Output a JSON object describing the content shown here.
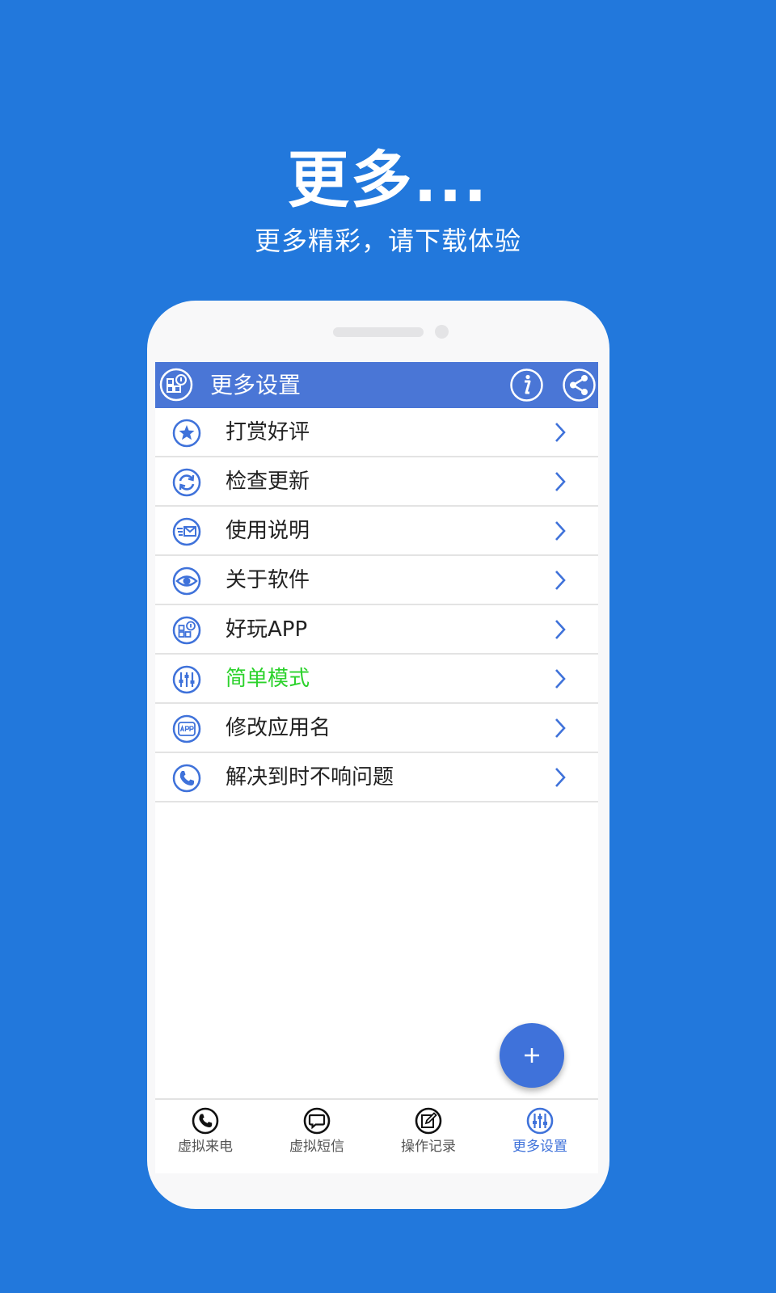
{
  "promo": {
    "title": "更多...",
    "subtitle": "更多精彩，请下载体验"
  },
  "appbar": {
    "title": "更多设置",
    "left_icon": "app-grid-icon",
    "right_icons": [
      "info-icon",
      "share-icon"
    ]
  },
  "menu": {
    "items": [
      {
        "label": "打赏好评",
        "icon": "star-icon"
      },
      {
        "label": "检查更新",
        "icon": "refresh-icon"
      },
      {
        "label": "使用说明",
        "icon": "mail-icon"
      },
      {
        "label": "关于软件",
        "icon": "eye-icon"
      },
      {
        "label": "好玩APP",
        "icon": "app-grid-icon"
      },
      {
        "label": "简单模式",
        "icon": "sliders-icon",
        "color": "#2CD22C"
      },
      {
        "label": "修改应用名",
        "icon": "app-label-icon"
      },
      {
        "label": "解决到时不响问题",
        "icon": "phone-icon"
      }
    ]
  },
  "fab": {
    "label": "+"
  },
  "tabs": [
    {
      "label": "虚拟来电",
      "icon": "phone-icon",
      "active": false
    },
    {
      "label": "虚拟短信",
      "icon": "message-icon",
      "active": false
    },
    {
      "label": "操作记录",
      "icon": "edit-icon",
      "active": false
    },
    {
      "label": "更多设置",
      "icon": "sliders-icon",
      "active": true
    }
  ],
  "colors": {
    "background": "#2278DC",
    "appbar": "#4A76D6",
    "accent": "#3F72DA",
    "highlight_green": "#2CD22C"
  }
}
